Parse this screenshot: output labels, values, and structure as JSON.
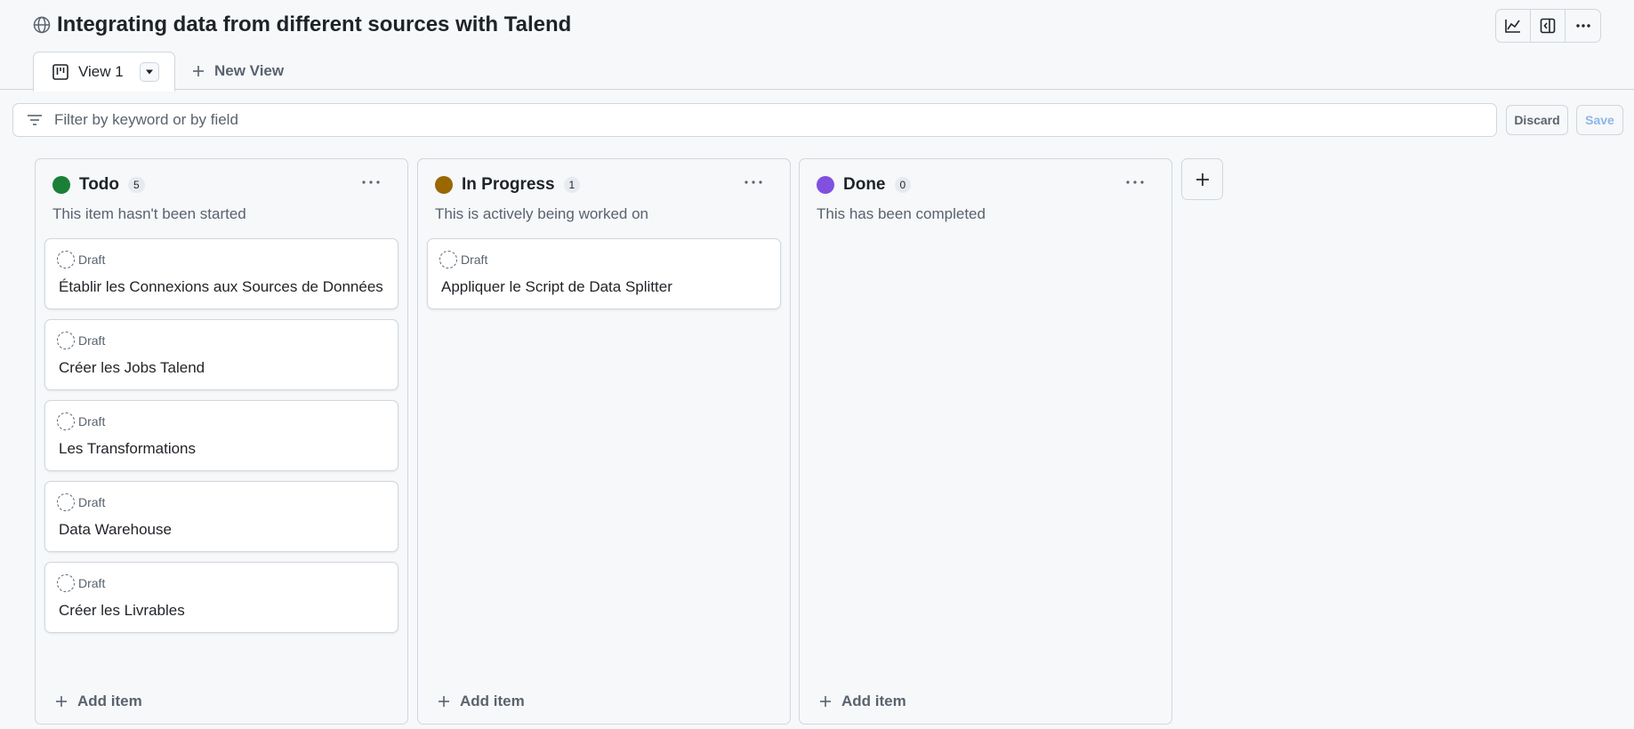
{
  "header": {
    "title": "Integrating data from different sources with Talend",
    "tabs": [
      {
        "label": "View 1"
      }
    ],
    "new_view_label": "New View",
    "actions": [
      "insights-icon",
      "panel-icon",
      "more-icon"
    ]
  },
  "filter": {
    "placeholder": "Filter by keyword or by field",
    "value": "",
    "discard_label": "Discard",
    "save_label": "Save"
  },
  "columns": [
    {
      "name": "Todo",
      "count": "5",
      "color": "#1a7f37",
      "description": "This item hasn't been started",
      "add_label": "Add item",
      "cards": [
        {
          "status": "Draft",
          "title": "Établir les Connexions aux Sources de Données"
        },
        {
          "status": "Draft",
          "title": "Créer les Jobs Talend"
        },
        {
          "status": "Draft",
          "title": "Les Transformations"
        },
        {
          "status": "Draft",
          "title": "Data Warehouse"
        },
        {
          "status": "Draft",
          "title": "Créer les Livrables"
        }
      ]
    },
    {
      "name": "In Progress",
      "count": "1",
      "color": "#9a6700",
      "description": "This is actively being worked on",
      "add_label": "Add item",
      "cards": [
        {
          "status": "Draft",
          "title": "Appliquer le Script de Data Splitter"
        }
      ]
    },
    {
      "name": "Done",
      "count": "0",
      "color": "#8250df",
      "description": "This has been completed",
      "add_label": "Add item",
      "cards": []
    }
  ]
}
